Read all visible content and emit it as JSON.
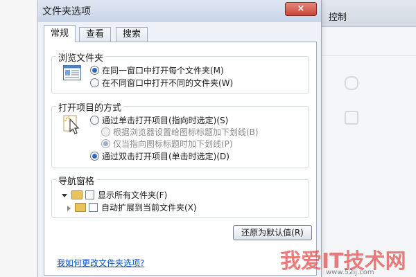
{
  "background": {
    "right_partial_text": "控制"
  },
  "dialog": {
    "title": "文件夹选项",
    "close_symbol": "×",
    "tabs": [
      {
        "label": "常规",
        "active": true
      },
      {
        "label": "查看",
        "active": false
      },
      {
        "label": "搜索",
        "active": false
      }
    ],
    "browse": {
      "title": "浏览文件夹",
      "options": [
        {
          "label": "在同一窗口中打开每个文件夹(M)",
          "selected": true
        },
        {
          "label": "在不同窗口中打开不同的文件夹(W)",
          "selected": false
        }
      ]
    },
    "click": {
      "title": "打开项目的方式",
      "single": {
        "label": "通过单击打开项目(指向时选定)(S)",
        "selected": false
      },
      "sub_options": [
        {
          "label": "根据浏览器设置给图标标题加下划线(B)",
          "selected": false
        },
        {
          "label": "仅当指向图标标题时加下划线(P)",
          "selected": true
        }
      ],
      "double": {
        "label": "通过双击打开项目(单击时选定)(D)",
        "selected": true
      }
    },
    "nav": {
      "title": "导航窗格",
      "options": [
        {
          "label": "显示所有文件夹(F)",
          "checked": false
        },
        {
          "label": "自动扩展到当前文件夹(X)",
          "checked": false
        }
      ]
    },
    "restore_button": "还原为默认值(R)",
    "help_link": "我如何更改文件夹选项?"
  },
  "watermark": {
    "text": "我爱IT技术网",
    "url": "www.52ij.com"
  },
  "colors": {
    "accent": "#2b6ac2",
    "link": "#0a52c6",
    "close": "#c74537"
  }
}
